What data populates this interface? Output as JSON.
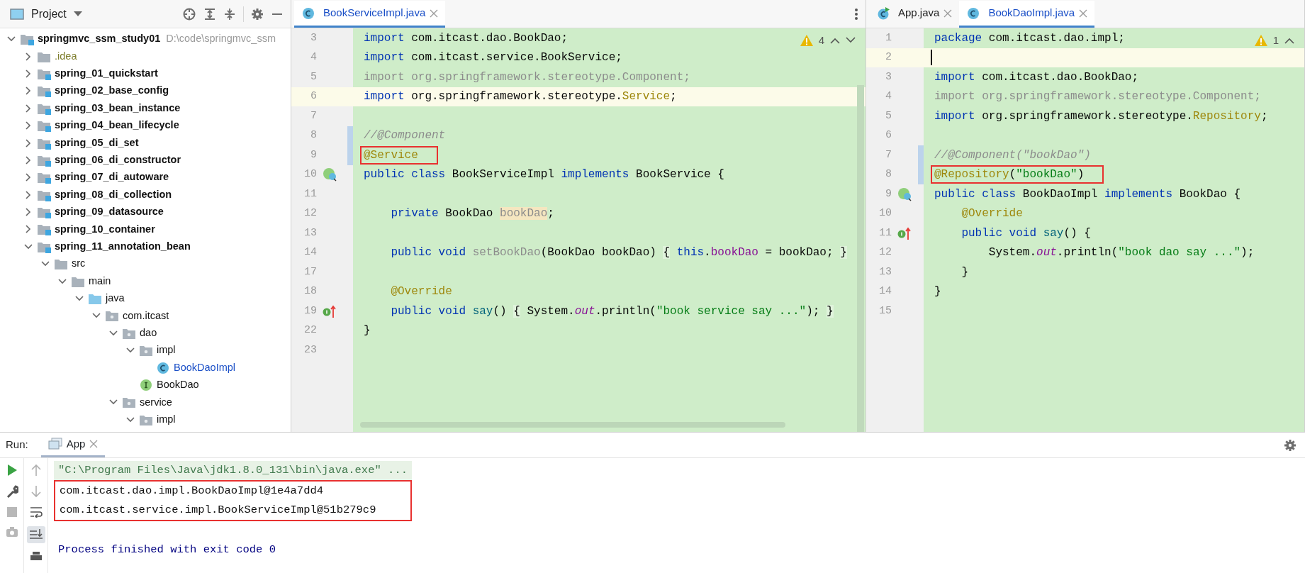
{
  "project": {
    "title": "Project",
    "tree": [
      {
        "label": "springmvc_ssm_study01",
        "path": "D:\\code\\springmvc_ssm",
        "kind": "module",
        "expanded": true,
        "children": [
          {
            "label": ".idea",
            "kind": "config-folder",
            "expanded": false
          },
          {
            "label": "spring_01_quickstart",
            "kind": "module",
            "expanded": false
          },
          {
            "label": "spring_02_base_config",
            "kind": "module",
            "expanded": false
          },
          {
            "label": "spring_03_bean_instance",
            "kind": "module",
            "expanded": false
          },
          {
            "label": "spring_04_bean_lifecycle",
            "kind": "module",
            "expanded": false
          },
          {
            "label": "spring_05_di_set",
            "kind": "module",
            "expanded": false
          },
          {
            "label": "spring_06_di_constructor",
            "kind": "module",
            "expanded": false
          },
          {
            "label": "spring_07_di_autoware",
            "kind": "module",
            "expanded": false
          },
          {
            "label": "spring_08_di_collection",
            "kind": "module",
            "expanded": false
          },
          {
            "label": "spring_09_datasource",
            "kind": "module",
            "expanded": false
          },
          {
            "label": "spring_10_container",
            "kind": "module",
            "expanded": false
          },
          {
            "label": "spring_11_annotation_bean",
            "kind": "module",
            "expanded": true,
            "children": [
              {
                "label": "src",
                "kind": "folder",
                "expanded": true,
                "children": [
                  {
                    "label": "main",
                    "kind": "folder",
                    "expanded": true,
                    "children": [
                      {
                        "label": "java",
                        "kind": "source-folder",
                        "expanded": true,
                        "children": [
                          {
                            "label": "com.itcast",
                            "kind": "package",
                            "expanded": true,
                            "children": [
                              {
                                "label": "dao",
                                "kind": "package",
                                "expanded": true,
                                "children": [
                                  {
                                    "label": "impl",
                                    "kind": "package",
                                    "expanded": true,
                                    "children": [
                                      {
                                        "label": "BookDaoImpl",
                                        "kind": "class",
                                        "modified": true
                                      }
                                    ]
                                  },
                                  {
                                    "label": "BookDao",
                                    "kind": "interface",
                                    "modified": false
                                  }
                                ]
                              },
                              {
                                "label": "service",
                                "kind": "package",
                                "expanded": true,
                                "children": [
                                  {
                                    "label": "impl",
                                    "kind": "package",
                                    "expanded": true
                                  }
                                ]
                              }
                            ]
                          }
                        ]
                      }
                    ]
                  }
                ]
              }
            ]
          }
        ]
      }
    ]
  },
  "editors": [
    {
      "tabs": [
        {
          "label": "BookServiceImpl.java",
          "kind": "class",
          "selected": true
        }
      ],
      "warnings": "4",
      "lines": [
        {
          "n": "3",
          "current": false,
          "changed": false,
          "boxed": false,
          "tokens": [
            {
              "kind": "kw",
              "text": "import"
            },
            {
              "kind": "plain",
              "text": " com.itcast.dao.BookDao;"
            }
          ]
        },
        {
          "n": "4",
          "current": false,
          "changed": false,
          "boxed": false,
          "tokens": [
            {
              "kind": "kw",
              "text": "import"
            },
            {
              "kind": "plain",
              "text": " com.itcast.service.BookService;"
            }
          ]
        },
        {
          "n": "5",
          "current": false,
          "changed": false,
          "boxed": false,
          "tokens": [
            {
              "kind": "unused",
              "text": "import org.springframework.stereotype.Component;"
            }
          ]
        },
        {
          "n": "6",
          "current": true,
          "changed": false,
          "boxed": false,
          "tokens": [
            {
              "kind": "kw",
              "text": "import"
            },
            {
              "kind": "plain",
              "text": " org.springframework.stereotype."
            },
            {
              "kind": "ann",
              "text": "Service"
            },
            {
              "kind": "plain",
              "text": ";"
            }
          ]
        },
        {
          "n": "7",
          "current": false,
          "changed": false,
          "boxed": false
        },
        {
          "n": "8",
          "current": false,
          "changed": true,
          "boxed": false,
          "tokens": [
            {
              "kind": "comment",
              "text": "//@Component"
            }
          ]
        },
        {
          "n": "9",
          "current": false,
          "changed": true,
          "boxed": true,
          "tokens": [
            {
              "kind": "ann",
              "text": "@Service"
            }
          ]
        },
        {
          "n": "10",
          "current": false,
          "changed": false,
          "boxed": false,
          "marker": {
            "kind": "implemented"
          },
          "tokens": [
            {
              "kind": "kw",
              "text": "public class"
            },
            {
              "kind": "plain",
              "text": " BookServiceImpl "
            },
            {
              "kind": "kw",
              "text": "implements"
            },
            {
              "kind": "plain",
              "text": " BookService {"
            }
          ]
        },
        {
          "n": "11",
          "current": false,
          "changed": false,
          "boxed": false
        },
        {
          "n": "12",
          "current": false,
          "changed": false,
          "boxed": false,
          "tokens": [
            {
              "kind": "kw",
              "text": "    private"
            },
            {
              "kind": "plain",
              "text": " BookDao "
            },
            {
              "kind": "unusedfield",
              "text": "bookDao"
            },
            {
              "kind": "plain",
              "text": ";"
            }
          ]
        },
        {
          "n": "13",
          "current": false,
          "changed": false,
          "boxed": false
        },
        {
          "n": "14",
          "current": false,
          "changed": false,
          "boxed": false,
          "tokens": [
            {
              "kind": "kw",
              "text": "    public void"
            },
            {
              "kind": "unused",
              "text": " setBookDao"
            },
            {
              "kind": "plain",
              "text": "(BookDao bookDao) "
            },
            {
              "kind": "fold",
              "text": "{"
            },
            {
              "kind": "kw",
              "text": " this"
            },
            {
              "kind": "plain",
              "text": "."
            },
            {
              "kind": "field",
              "text": "bookDao"
            },
            {
              "kind": "plain",
              "text": " = bookDao; "
            },
            {
              "kind": "fold",
              "text": "}"
            }
          ]
        },
        {
          "n": "17",
          "current": false,
          "changed": false,
          "boxed": false
        },
        {
          "n": "18",
          "current": false,
          "changed": false,
          "boxed": false,
          "tokens": [
            {
              "kind": "ann",
              "text": "    @Override"
            }
          ]
        },
        {
          "n": "19",
          "current": false,
          "changed": false,
          "boxed": false,
          "marker": {
            "kind": "overrides"
          },
          "tokens": [
            {
              "kind": "kw",
              "text": "    public void"
            },
            {
              "kind": "method",
              "text": " say"
            },
            {
              "kind": "plain",
              "text": "() "
            },
            {
              "kind": "fold",
              "text": "{"
            },
            {
              "kind": "plain",
              "text": " System."
            },
            {
              "kind": "static",
              "text": "out"
            },
            {
              "kind": "plain",
              "text": ".println("
            },
            {
              "kind": "str",
              "text": "\"book service say ...\""
            },
            {
              "kind": "plain",
              "text": "); "
            },
            {
              "kind": "fold",
              "text": "}"
            }
          ]
        },
        {
          "n": "22",
          "current": false,
          "changed": false,
          "boxed": false,
          "tokens": [
            {
              "kind": "plain",
              "text": "}"
            }
          ]
        },
        {
          "n": "23",
          "current": false,
          "changed": false,
          "boxed": false
        }
      ]
    },
    {
      "tabs": [
        {
          "label": "App.java",
          "kind": "runnable-class",
          "selected": false
        },
        {
          "label": "BookDaoImpl.java",
          "kind": "class",
          "selected": true
        }
      ],
      "warnings": "1",
      "lines": [
        {
          "n": "1",
          "current": false,
          "changed": false,
          "boxed": false,
          "tokens": [
            {
              "kind": "kw",
              "text": "package"
            },
            {
              "kind": "plain",
              "text": " com.itcast.dao.impl;"
            }
          ]
        },
        {
          "n": "2",
          "current": true,
          "changed": false,
          "boxed": false
        },
        {
          "n": "3",
          "current": false,
          "changed": false,
          "boxed": false,
          "tokens": [
            {
              "kind": "kw",
              "text": "import"
            },
            {
              "kind": "plain",
              "text": " com.itcast.dao.BookDao;"
            }
          ]
        },
        {
          "n": "4",
          "current": false,
          "changed": false,
          "boxed": false,
          "tokens": [
            {
              "kind": "unused",
              "text": "import org.springframework.stereotype.Component;"
            }
          ]
        },
        {
          "n": "5",
          "current": false,
          "changed": false,
          "boxed": false,
          "tokens": [
            {
              "kind": "kw",
              "text": "import"
            },
            {
              "kind": "plain",
              "text": " org.springframework.stereotype."
            },
            {
              "kind": "ann",
              "text": "Repository"
            },
            {
              "kind": "plain",
              "text": ";"
            }
          ]
        },
        {
          "n": "6",
          "current": false,
          "changed": false,
          "boxed": false
        },
        {
          "n": "7",
          "current": false,
          "changed": true,
          "boxed": false,
          "tokens": [
            {
              "kind": "comment",
              "text": "//@Component(\"bookDao\")"
            }
          ]
        },
        {
          "n": "8",
          "current": false,
          "changed": true,
          "boxed": true,
          "tokens": [
            {
              "kind": "ann",
              "text": "@Repository"
            },
            {
              "kind": "plain",
              "text": "("
            },
            {
              "kind": "str",
              "text": "\"bookDao\""
            },
            {
              "kind": "plain",
              "text": ")"
            }
          ]
        },
        {
          "n": "9",
          "current": false,
          "changed": false,
          "boxed": false,
          "marker": {
            "kind": "implemented"
          },
          "tokens": [
            {
              "kind": "kw",
              "text": "public class"
            },
            {
              "kind": "plain",
              "text": " BookDaoImpl "
            },
            {
              "kind": "kw",
              "text": "implements"
            },
            {
              "kind": "plain",
              "text": " BookDao {"
            }
          ]
        },
        {
          "n": "10",
          "current": false,
          "changed": false,
          "boxed": false,
          "tokens": [
            {
              "kind": "ann",
              "text": "    @Override"
            }
          ]
        },
        {
          "n": "11",
          "current": false,
          "changed": false,
          "boxed": false,
          "marker": {
            "kind": "overrides"
          },
          "tokens": [
            {
              "kind": "kw",
              "text": "    public void"
            },
            {
              "kind": "method",
              "text": " say"
            },
            {
              "kind": "plain",
              "text": "() {"
            }
          ]
        },
        {
          "n": "12",
          "current": false,
          "changed": false,
          "boxed": false,
          "tokens": [
            {
              "kind": "plain",
              "text": "        System."
            },
            {
              "kind": "static",
              "text": "out"
            },
            {
              "kind": "plain",
              "text": ".println("
            },
            {
              "kind": "str",
              "text": "\"book dao say ...\""
            },
            {
              "kind": "plain",
              "text": ");"
            }
          ]
        },
        {
          "n": "13",
          "current": false,
          "changed": false,
          "boxed": false,
          "tokens": [
            {
              "kind": "plain",
              "text": "    }"
            }
          ]
        },
        {
          "n": "14",
          "current": false,
          "changed": false,
          "boxed": false,
          "tokens": [
            {
              "kind": "plain",
              "text": "}"
            }
          ]
        },
        {
          "n": "15",
          "current": false,
          "changed": false,
          "boxed": false
        }
      ]
    }
  ],
  "run": {
    "label": "Run:",
    "tabs": [
      {
        "label": "App",
        "selected": true
      }
    ],
    "output": [
      {
        "kind": "command",
        "text": "\"C:\\Program Files\\Java\\jdk1.8.0_131\\bin\\java.exe\" ...",
        "boxed": false
      },
      {
        "kind": "stdout",
        "text": "com.itcast.dao.impl.BookDaoImpl@1e4a7dd4",
        "boxed": true
      },
      {
        "kind": "stdout",
        "text": "com.itcast.service.impl.BookServiceImpl@51b279c9",
        "boxed": true
      },
      {
        "kind": "exit",
        "text": "Process finished with exit code 0",
        "boxed": false
      }
    ]
  }
}
